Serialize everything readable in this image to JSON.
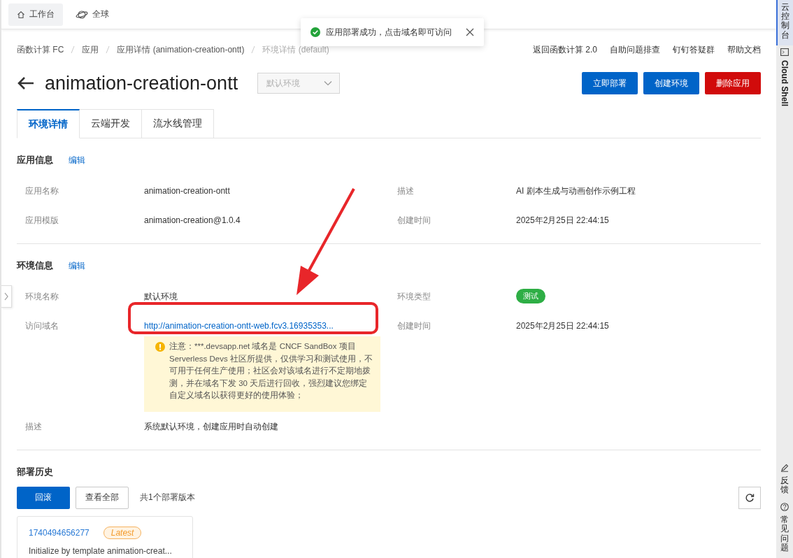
{
  "topbar": {
    "items": [
      {
        "label": "工作台",
        "selected": true
      },
      {
        "label": "全球",
        "selected": false
      }
    ]
  },
  "toast": {
    "kind": "success",
    "message": "应用部署成功，点击域名即可访问"
  },
  "breadcrumb": [
    "函数计算 FC",
    "应用",
    "应用详情 (animation-creation-ontt)",
    "环境详情 (default)"
  ],
  "header_links": [
    "返回函数计算 2.0",
    "自助问题排查",
    "钉钉答疑群",
    "帮助文档"
  ],
  "title": "animation-creation-ontt",
  "env_select": {
    "value": "默认环境",
    "disabled": true
  },
  "actions": [
    {
      "label": "立即部署",
      "kind": "primary"
    },
    {
      "label": "创建环境",
      "kind": "primary"
    },
    {
      "label": "删除应用",
      "kind": "danger"
    }
  ],
  "tabs": [
    {
      "label": "环境详情",
      "selected": true
    },
    {
      "label": "云端开发",
      "selected": false
    },
    {
      "label": "流水线管理",
      "selected": false
    }
  ],
  "app_info": {
    "title": "应用信息",
    "edit": "编辑",
    "fields": [
      {
        "label": "应用名称",
        "value": "animation-creation-ontt"
      },
      {
        "label": "描述",
        "value": "AI 剧本生成与动画创作示例工程"
      },
      {
        "label": "应用模版",
        "value": "animation-creation@1.0.4"
      },
      {
        "label": "创建时间",
        "value": "2025年2月25日 22:44:15"
      }
    ]
  },
  "env_info": {
    "title": "环境信息",
    "edit": "编辑",
    "fields": [
      {
        "label": "环境名称",
        "value": "默认环境",
        "kind": "text"
      },
      {
        "label": "环境类型",
        "value": "测试",
        "kind": "tag"
      },
      {
        "label": "访问域名",
        "value": "http://animation-creation-ontt-web.fcv3.16935353...",
        "kind": "link",
        "notice": "注意：***.devsapp.net 域名是 CNCF SandBox 项目 Serverless Devs 社区所提供，仅供学习和测试使用，不可用于任何生产使用；社区会对该域名进行不定期地拨测，并在域名下发 30 天后进行回收，强烈建议您绑定自定义域名以获得更好的使用体验；"
      },
      {
        "label": "创建时间",
        "value": "2025年2月25日 22:44:15",
        "kind": "text"
      },
      {
        "label": "描述",
        "value": "系统默认环境，创建应用时自动创建",
        "kind": "wide"
      }
    ]
  },
  "history": {
    "title": "部署历史",
    "buttons": [
      {
        "label": "回滚",
        "kind": "primary"
      },
      {
        "label": "查看全部",
        "kind": "default"
      }
    ],
    "count": "共1个部署版本",
    "versions": [
      {
        "id": "1740494656277",
        "badge": "Latest",
        "message": "Initialize by template animation-creat..."
      }
    ]
  },
  "side_rail": [
    {
      "label": "云控制台",
      "selected": true,
      "kind": "cjk"
    },
    {
      "label": "Cloud Shell",
      "selected": false,
      "kind": "latin"
    },
    {
      "label": "反馈",
      "selected": false,
      "kind": "cjk"
    },
    {
      "label": "常见问题",
      "selected": false,
      "kind": "cjk"
    }
  ]
}
